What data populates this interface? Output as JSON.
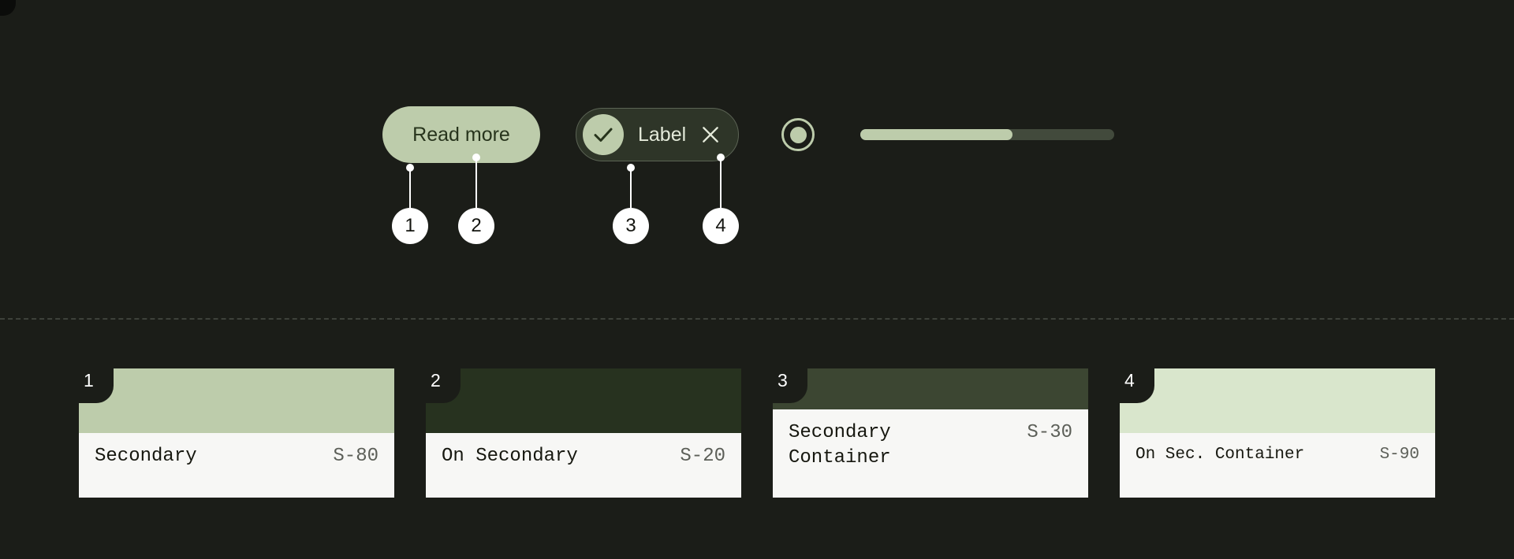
{
  "theme": {
    "background": "#1b1d18",
    "accent": "#bdccab",
    "accent_dark": "#27341c",
    "chip_background": "#2e3528",
    "chip_border": "#5c6455",
    "track_inactive": "#424a3c",
    "divider": "#3d413a",
    "callout_background": "#ffffff",
    "callout_text": "#141510",
    "card_info_background": "#f7f7f5"
  },
  "specimens": {
    "button": {
      "label": "Read more",
      "icon": "none"
    },
    "chip": {
      "label": "Label",
      "leading_icon": "check-icon",
      "trailing_icon": "close-icon"
    },
    "radio": {
      "state": "selected",
      "icon": "radio-selected-icon"
    },
    "slider": {
      "value_percent": 60,
      "fill_percent": "60%"
    }
  },
  "callouts": [
    {
      "number": "1",
      "target": "button-container"
    },
    {
      "number": "2",
      "target": "button-label"
    },
    {
      "number": "3",
      "target": "chip-check-icon"
    },
    {
      "number": "4",
      "target": "chip-close-icon"
    }
  ],
  "cards": [
    {
      "badge": "1",
      "name": "Secondary",
      "token": "S-80",
      "swatch": "#bdccab",
      "swatch_height": 82,
      "compact": false
    },
    {
      "badge": "2",
      "name": "On Secondary",
      "token": "S-20",
      "swatch": "#27321f",
      "swatch_height": 82,
      "compact": false
    },
    {
      "badge": "3",
      "name": "Secondary\nContainer",
      "token": "S-30",
      "swatch": "#3c4632",
      "swatch_height": 52,
      "compact": false
    },
    {
      "badge": "4",
      "name": "On Sec. Container",
      "token": "S-90",
      "swatch": "#d9e6cc",
      "swatch_height": 82,
      "compact": true
    }
  ]
}
